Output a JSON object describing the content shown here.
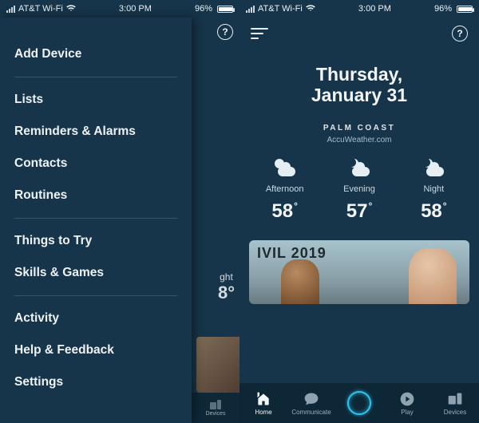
{
  "status": {
    "carrier": "AT&T Wi-Fi",
    "time": "3:00 PM",
    "battery_pct": "96%"
  },
  "drawer": {
    "items": [
      "Add Device",
      "Lists",
      "Reminders & Alarms",
      "Contacts",
      "Routines",
      "Things to Try",
      "Skills & Games",
      "Activity",
      "Help & Feedback",
      "Settings"
    ],
    "dividers_after": [
      0,
      4,
      6
    ]
  },
  "backdrop_peek": {
    "period": "ght",
    "temp": "8°",
    "tab_label": "Devices"
  },
  "home": {
    "date_line1": "Thursday,",
    "date_line2": "January 31",
    "location": "PALM COAST",
    "source": "AccuWeather.com",
    "forecast": [
      {
        "period": "Afternoon",
        "temp": "58",
        "icon": "sun-cloud"
      },
      {
        "period": "Evening",
        "temp": "57",
        "icon": "moon-cloud"
      },
      {
        "period": "Night",
        "temp": "58",
        "icon": "moon-cloud"
      }
    ],
    "card_banner": "IVIL 2019"
  },
  "tabs": [
    {
      "label": "Home",
      "icon": "home",
      "active": true
    },
    {
      "label": "Communicate",
      "icon": "chat",
      "active": false
    },
    {
      "label": "",
      "icon": "alexa",
      "active": false
    },
    {
      "label": "Play",
      "icon": "play",
      "active": false
    },
    {
      "label": "Devices",
      "icon": "devices",
      "active": false
    }
  ]
}
